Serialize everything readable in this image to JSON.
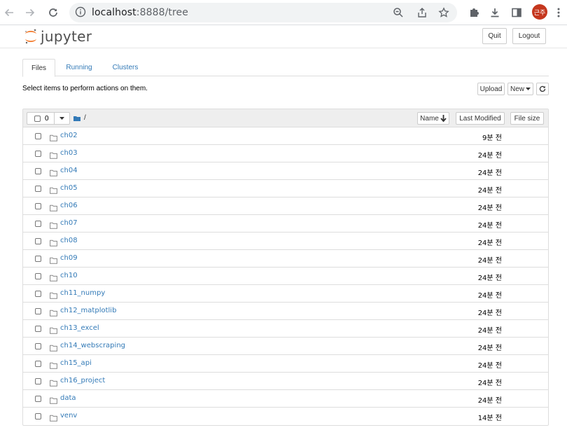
{
  "browser": {
    "url_host": "localhost",
    "url_path": ":8888/tree",
    "profile_initials": "근주"
  },
  "header": {
    "logo_text": "jupyter",
    "quit_label": "Quit",
    "logout_label": "Logout"
  },
  "tabs": [
    {
      "label": "Files"
    },
    {
      "label": "Running"
    },
    {
      "label": "Clusters"
    }
  ],
  "toolbar": {
    "hint": "Select items to perform actions on them.",
    "upload_label": "Upload",
    "new_label": "New"
  },
  "list_header": {
    "selected_count": "0",
    "path": "/",
    "sort_name_label": "Name",
    "sort_modified_label": "Last Modified",
    "sort_size_label": "File size"
  },
  "files": [
    {
      "name": "ch02",
      "modified": "9분 전"
    },
    {
      "name": "ch03",
      "modified": "24분 전"
    },
    {
      "name": "ch04",
      "modified": "24분 전"
    },
    {
      "name": "ch05",
      "modified": "24분 전"
    },
    {
      "name": "ch06",
      "modified": "24분 전"
    },
    {
      "name": "ch07",
      "modified": "24분 전"
    },
    {
      "name": "ch08",
      "modified": "24분 전"
    },
    {
      "name": "ch09",
      "modified": "24분 전"
    },
    {
      "name": "ch10",
      "modified": "24분 전"
    },
    {
      "name": "ch11_numpy",
      "modified": "24분 전"
    },
    {
      "name": "ch12_matplotlib",
      "modified": "24분 전"
    },
    {
      "name": "ch13_excel",
      "modified": "24분 전"
    },
    {
      "name": "ch14_webscraping",
      "modified": "24분 전"
    },
    {
      "name": "ch15_api",
      "modified": "24분 전"
    },
    {
      "name": "ch16_project",
      "modified": "24분 전"
    },
    {
      "name": "data",
      "modified": "24분 전"
    },
    {
      "name": "venv",
      "modified": "14분 전"
    }
  ],
  "colors": {
    "link": "#337ab7",
    "avatar": "#c5371e",
    "logo_orange": "#f37726"
  }
}
